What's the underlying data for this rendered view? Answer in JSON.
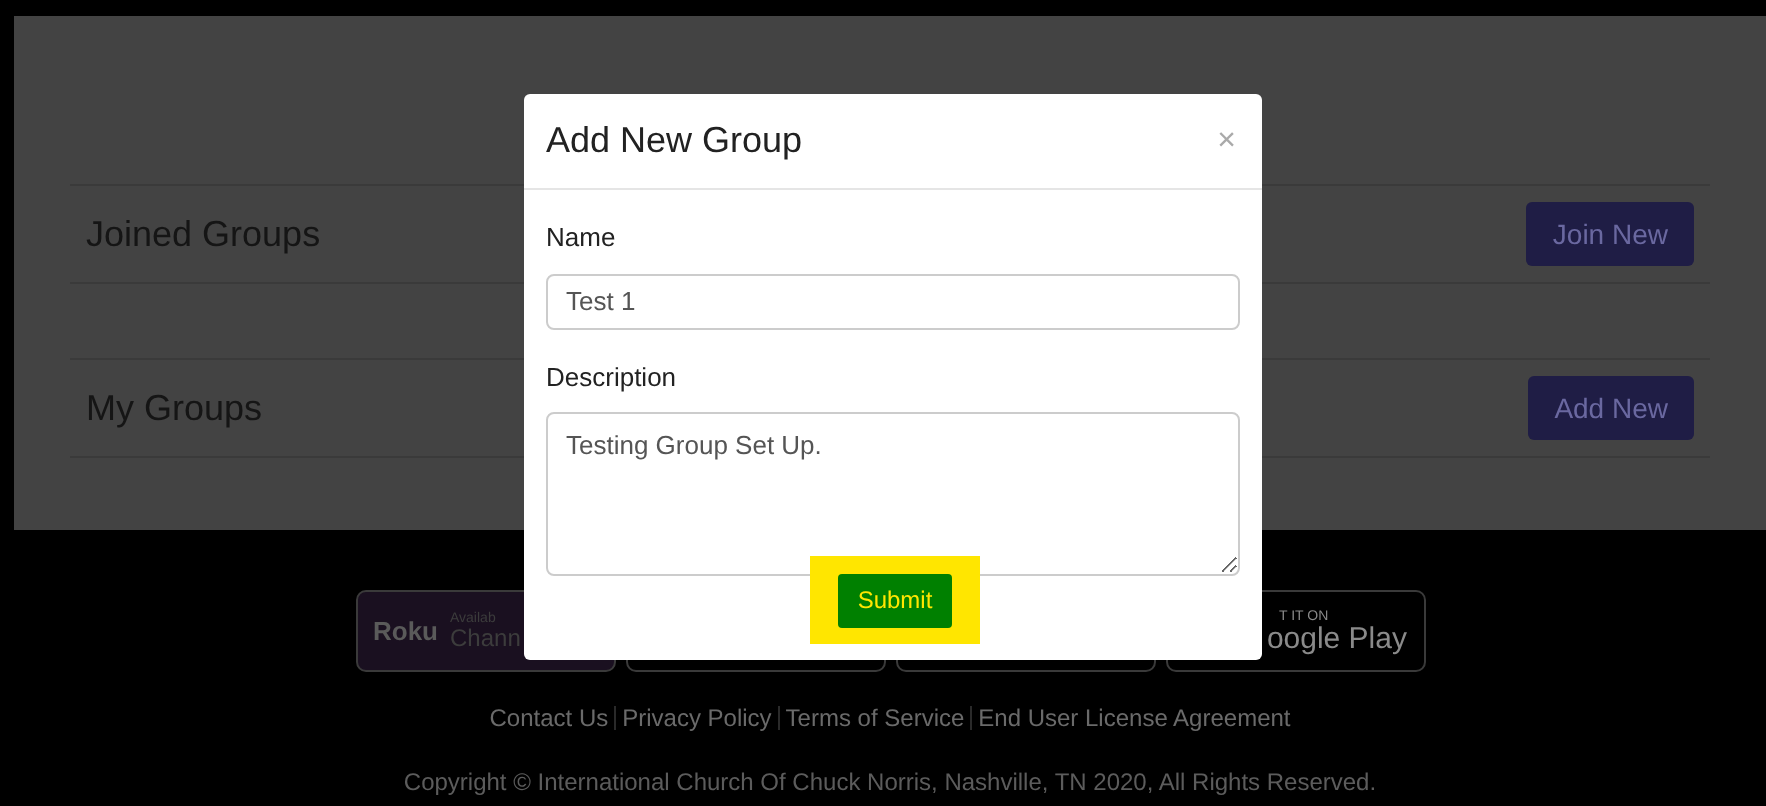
{
  "sections": [
    {
      "title": "Joined Groups",
      "button": "Join New"
    },
    {
      "title": "My Groups",
      "button": "Add New"
    }
  ],
  "badges": [
    {
      "kind": "roku",
      "logo": "Roku",
      "line1": "Availab",
      "line2": "Chann"
    },
    {
      "kind": "blank"
    },
    {
      "kind": "blank"
    },
    {
      "kind": "google",
      "line1": "T IT ON",
      "line2": "oogle Play"
    }
  ],
  "footer_links": [
    "Contact Us",
    "Privacy Policy",
    "Terms of Service",
    "End User License Agreement"
  ],
  "copyright": "Copyright © International Church Of Chuck Norris, Nashville, TN 2020, All Rights Reserved.",
  "modal": {
    "title": "Add New Group",
    "close": "×",
    "fields": [
      {
        "kind": "input",
        "label": "Name",
        "value": "Test 1"
      },
      {
        "kind": "textarea",
        "label": "Description",
        "value": "Testing Group Set Up."
      }
    ],
    "submit": "Submit"
  }
}
